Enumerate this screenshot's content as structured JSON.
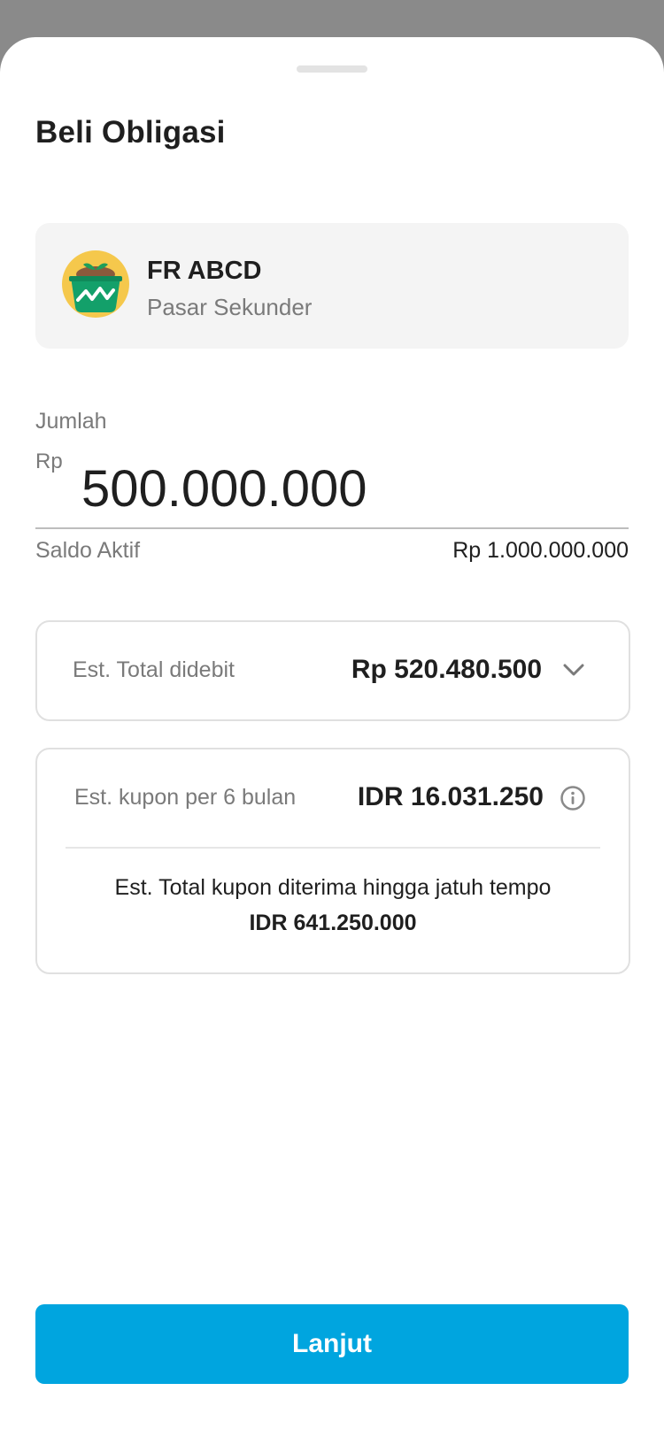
{
  "sheet": {
    "title": "Beli Obligasi"
  },
  "product": {
    "name": "FR ABCD",
    "market": "Pasar Sekunder",
    "icon": "bond-plant-icon"
  },
  "amount": {
    "label": "Jumlah",
    "currency": "Rp",
    "value": "500.000.000"
  },
  "balance": {
    "label": "Saldo Aktif",
    "value": "Rp 1.000.000.000"
  },
  "debit": {
    "label": "Est. Total didebit",
    "value": "Rp 520.480.500",
    "icon": "chevron-down-icon"
  },
  "coupon": {
    "per_period_label": "Est. kupon per 6 bulan",
    "per_period_value": "IDR 16.031.250",
    "info_icon": "info-icon",
    "total_label": "Est. Total kupon diterima hingga jatuh tempo",
    "total_value": "IDR 641.250.000"
  },
  "cta": {
    "label": "Lanjut"
  },
  "colors": {
    "accent": "#00a5df",
    "icon_green": "#13a06a",
    "icon_yellow": "#f5c84c",
    "backdrop": "#8a8a8a"
  }
}
